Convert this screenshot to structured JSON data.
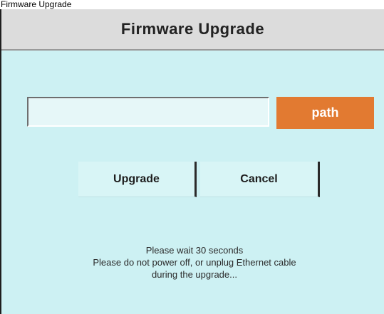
{
  "page": {
    "top_text": "Firmware Upgrade"
  },
  "dialog": {
    "title": "Firmware Upgrade",
    "path_input": {
      "value": "",
      "placeholder": ""
    },
    "path_button_label": "path",
    "buttons": {
      "upgrade_label": "Upgrade",
      "cancel_label": "Cancel"
    },
    "notice": {
      "line1": "Please wait 30 seconds",
      "line2": "Please do not power off, or unplug Ethernet cable",
      "line3": "during the upgrade..."
    }
  },
  "colors": {
    "dialog_bg": "#cdf1f3",
    "header_bg": "#dcdcdc",
    "path_button_bg": "#e27a31"
  }
}
